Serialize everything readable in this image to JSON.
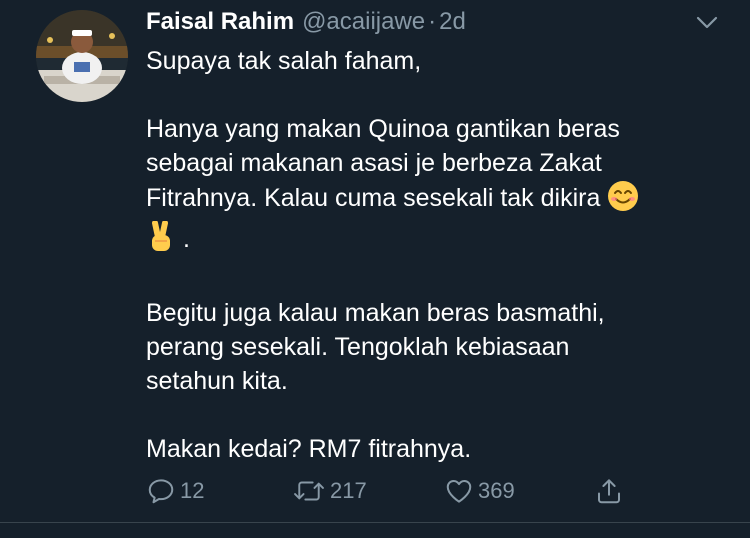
{
  "author": {
    "name": "Faisal Rahim",
    "handle": "@acaiijawe",
    "separator": "·",
    "time": "2d"
  },
  "tweet": {
    "line1": "Supaya tak salah faham,",
    "para2_a": "Hanya yang makan Quinoa gantikan beras",
    "para2_b": "sebagai makanan asasi je berbeza Zakat",
    "para2_c": "Fitrahnya. Kalau cuma sesekali tak dikira",
    "para2_d": ".",
    "para3_a": "Begitu juga kalau makan beras basmathi,",
    "para3_b": "perang sesekali. Tengoklah kebiasaan",
    "para3_c": "setahun kita.",
    "para4": "Makan kedai? RM7 fitrahnya.",
    "emojis": [
      "smiling-face-emoji",
      "victory-hand-emoji"
    ]
  },
  "actions": {
    "replies": "12",
    "retweets": "217",
    "likes": "369"
  },
  "icons": [
    "chevron-down-icon",
    "reply-icon",
    "retweet-icon",
    "like-icon",
    "share-icon"
  ],
  "colors": {
    "background": "#15202b",
    "text": "#ffffff",
    "secondary": "#8899a6",
    "divider": "#38444d"
  }
}
